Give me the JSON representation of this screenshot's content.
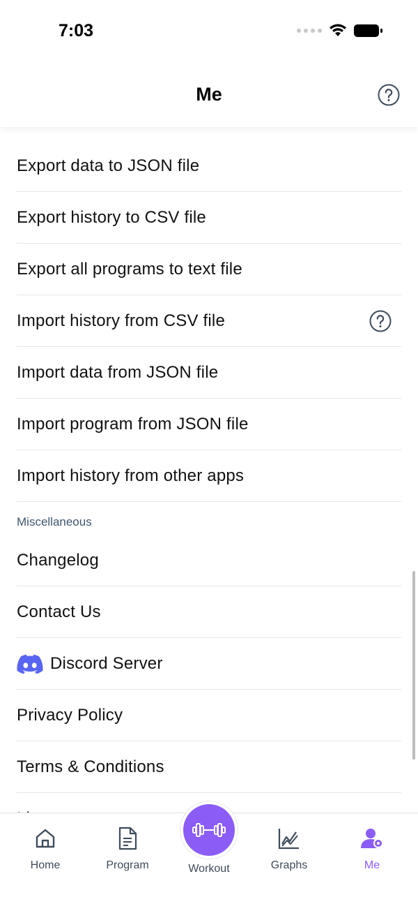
{
  "status_bar": {
    "time": "7:03"
  },
  "header": {
    "title": "Me"
  },
  "export_items": [
    {
      "label": "Export data to JSON file"
    },
    {
      "label": "Export history to CSV file"
    },
    {
      "label": "Export all programs to text file"
    },
    {
      "label": "Import history from CSV file"
    },
    {
      "label": "Import data from JSON file"
    },
    {
      "label": "Import program from JSON file"
    },
    {
      "label": "Import history from other apps"
    }
  ],
  "misc_section": {
    "title": "Miscellaneous",
    "items": [
      {
        "label": "Changelog"
      },
      {
        "label": "Contact Us"
      },
      {
        "label": "Discord Server"
      },
      {
        "label": "Privacy Policy"
      },
      {
        "label": "Terms & Conditions"
      },
      {
        "label": "Li"
      }
    ]
  },
  "tab_bar": {
    "home": "Home",
    "program": "Program",
    "workout": "Workout",
    "graphs": "Graphs",
    "me": "Me"
  },
  "colors": {
    "accent": "#8b5cf6",
    "discord": "#5865F2",
    "section_label": "#3e5670"
  }
}
